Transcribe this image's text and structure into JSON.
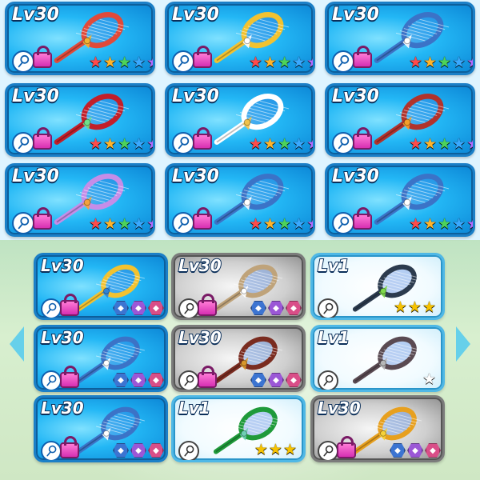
{
  "top_grid": [
    {
      "level": "Lv30",
      "stars": 5,
      "style": "blue",
      "racket_color": "#e04a3a",
      "accent": "#f3b232"
    },
    {
      "level": "Lv30",
      "stars": 5,
      "style": "blue",
      "racket_color": "#f2c230",
      "accent": "#ffffff"
    },
    {
      "level": "Lv30",
      "stars": 5,
      "style": "blue",
      "racket_color": "#3b73c7",
      "accent": "#ffffff"
    },
    {
      "level": "Lv30",
      "stars": 5,
      "style": "blue",
      "racket_color": "#c21f2a",
      "accent": "#6fe08a"
    },
    {
      "level": "Lv30",
      "stars": 5,
      "style": "blue",
      "racket_color": "#ffffff",
      "accent": "#f0c24a"
    },
    {
      "level": "Lv30",
      "stars": 5,
      "style": "blue",
      "racket_color": "#b1332c",
      "accent": "#f59f2b"
    },
    {
      "level": "Lv30",
      "stars": 5,
      "style": "blue",
      "racket_color": "#c58de8",
      "accent": "#f2a23c"
    },
    {
      "level": "Lv30",
      "stars": 5,
      "style": "blue",
      "racket_color": "#3b73c7",
      "accent": "#ffffff"
    },
    {
      "level": "Lv30",
      "stars": 5,
      "style": "blue",
      "racket_color": "#3b73c7",
      "accent": "#ffffff"
    }
  ],
  "bottom_grid": [
    {
      "level": "Lv30",
      "style": "blue",
      "racket_color": "#f2c230",
      "accent": "#2e83d8",
      "footer": "hexes"
    },
    {
      "level": "Lv30",
      "style": "gray",
      "racket_color": "#bfa37a",
      "accent": "#ffffff",
      "footer": "hexes"
    },
    {
      "level": "Lv1",
      "style": "white",
      "racket_color": "#2c3b4e",
      "accent": "#7ed84b",
      "footer": "stars",
      "stars": 3,
      "star_color": "#f6c200"
    },
    {
      "level": "Lv30",
      "style": "blue",
      "racket_color": "#3b73c7",
      "accent": "#ffffff",
      "footer": "hexes"
    },
    {
      "level": "Lv30",
      "style": "gray",
      "racket_color": "#7a2c20",
      "accent": "#d8962a",
      "footer": "hexes"
    },
    {
      "level": "Lv1",
      "style": "white",
      "racket_color": "#5a4a52",
      "accent": "#b7b7b7",
      "footer": "stars",
      "stars": 1,
      "star_color": "#ffffff"
    },
    {
      "level": "Lv30",
      "style": "blue",
      "racket_color": "#3b73c7",
      "accent": "#ffffff",
      "footer": "hexes"
    },
    {
      "level": "Lv1",
      "style": "white",
      "racket_color": "#1f9a3a",
      "accent": "#6fcfb4",
      "footer": "stars",
      "stars": 3,
      "star_color": "#f6c200"
    },
    {
      "level": "Lv30",
      "style": "gray",
      "racket_color": "#e7a01f",
      "accent": "#f6d13a",
      "footer": "hexes"
    }
  ],
  "nav": {
    "left_arrow": "left-arrow-icon",
    "right_arrow": "right-arrow-icon"
  },
  "colors": {
    "rainbow_stars": [
      "#ff4b4b",
      "#ffb42a",
      "#4dd35a",
      "#3aa9ff",
      "#b66bff"
    ],
    "hex_colors": [
      "#3c74d1",
      "#9b57d6",
      "#d94e88"
    ]
  }
}
